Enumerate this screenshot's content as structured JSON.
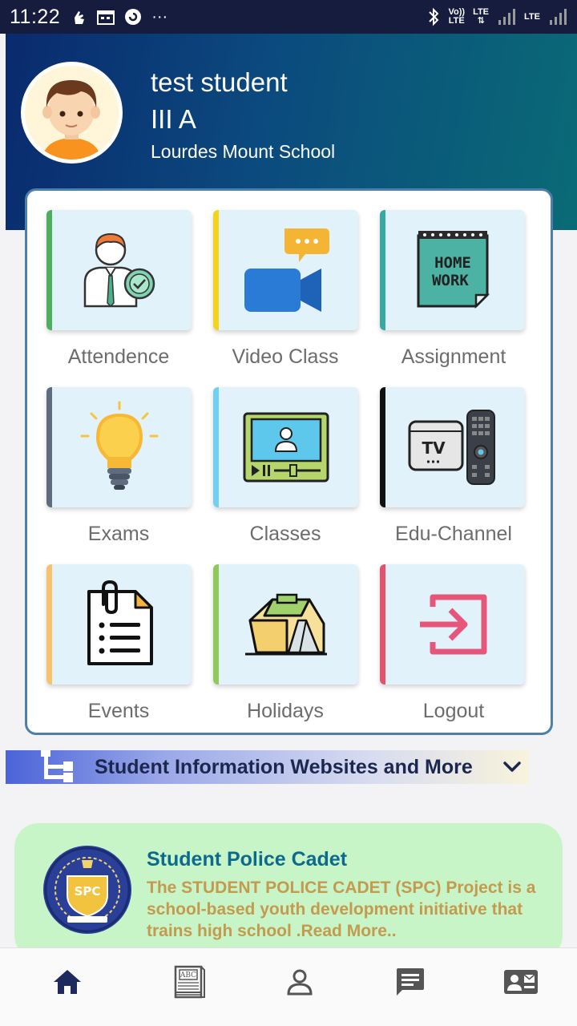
{
  "status_bar": {
    "time": "11:22",
    "more": "···",
    "volte": "Vo))",
    "lte1": "LTE",
    "lte2": "LTE"
  },
  "profile": {
    "name": "test student",
    "class": "III A",
    "school": "Lourdes Mount School"
  },
  "menu": [
    {
      "label": "Attendence",
      "stripe": "#4caf60"
    },
    {
      "label": "Video Class",
      "stripe": "#f5d31c"
    },
    {
      "label": "Assignment",
      "stripe": "#3aa8a2"
    },
    {
      "label": "Exams",
      "stripe": "#5f6b7e"
    },
    {
      "label": "Classes",
      "stripe": "#6fd0f2"
    },
    {
      "label": "Edu-Channel",
      "stripe": "#111111"
    },
    {
      "label": "Events",
      "stripe": "#f7c26d"
    },
    {
      "label": "Holidays",
      "stripe": "#8fc95a"
    },
    {
      "label": "Logout",
      "stripe": "#e0556d"
    }
  ],
  "icon_text": {
    "homework1": "HOME",
    "homework2": "WORK",
    "tv": "TV",
    "spc": "SPC"
  },
  "info_banner": {
    "label": "Student Information Websites and More"
  },
  "spc_card": {
    "title": "Student Police Cadet",
    "description": "The STUDENT POLICE CADET (SPC) Project is a school-based youth development initiative that trains high school .Read More.."
  },
  "bottom_nav": [
    "home-icon",
    "book-icon",
    "person-icon",
    "chat-icon",
    "contact-card-icon"
  ],
  "colors": {
    "statusbar": "#151c3d",
    "header_start": "#0a2a6e",
    "header_end": "#0a6b76",
    "nav_active": "#1c2a5e",
    "nav_inactive": "#555555"
  }
}
